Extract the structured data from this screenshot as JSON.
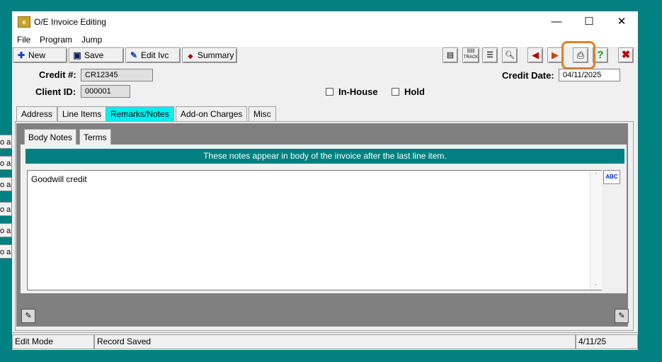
{
  "background_strips": [
    "o a",
    "o a",
    "o a",
    "o a",
    "o a",
    "o a"
  ],
  "window": {
    "title": "O/E Invoice Editing",
    "controls": [
      "—",
      "☐",
      "✕"
    ]
  },
  "menu": [
    "File",
    "Program",
    "Jump"
  ],
  "toolbar": {
    "new_label": "New",
    "save_label": "Save",
    "edit_label": "Edit Ivc",
    "summary_label": "Summary",
    "icon_buttons": [
      "copy-icon",
      "barcode-track-icon",
      "document-list-icon",
      "search-icon",
      "back-arrow-icon",
      "forward-arrow-icon",
      "print-icon",
      "help-icon",
      "close-x-icon"
    ],
    "track_text": "TRACK"
  },
  "form": {
    "credit_label": "Credit #:",
    "credit_value": "CR12345",
    "client_label": "Client ID:",
    "client_value": "000001",
    "inhouse_label": "In-House",
    "hold_label": "Hold",
    "credit_date_label": "Credit Date:",
    "credit_date_value": "04/11/2025"
  },
  "tabs": [
    "Address",
    "Line Items",
    "Remarks/Notes",
    "Add-on Charges",
    "Misc"
  ],
  "active_tab": "Remarks/Notes",
  "subtabs": [
    "Body Notes",
    "Terms"
  ],
  "notes": {
    "banner": "These notes appear in body of the invoice after the last line item.",
    "text": "Goodwill credit",
    "spell_text": "ABC"
  },
  "status": {
    "mode": "Edit Mode",
    "message": "Record Saved",
    "date": "4/11/25"
  },
  "colors": {
    "desktop": "#008080",
    "active_tab": "#00f0f0",
    "banner": "#008080",
    "highlight": "#e67e22"
  }
}
